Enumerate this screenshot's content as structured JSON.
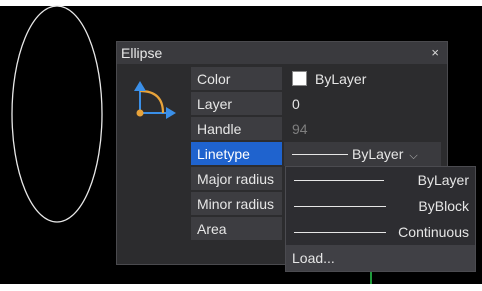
{
  "panel": {
    "title": "Ellipse",
    "close_label": "×"
  },
  "properties": [
    {
      "label": "Color",
      "value": "ByLayer",
      "swatch_color": "#ffffff"
    },
    {
      "label": "Layer",
      "value": "0"
    },
    {
      "label": "Handle",
      "value": "94"
    },
    {
      "label": "Linetype",
      "value": "ByLayer",
      "selected": true
    },
    {
      "label": "Major radius",
      "value": ""
    },
    {
      "label": "Minor radius",
      "value": ""
    },
    {
      "label": "Area",
      "value": ""
    }
  ],
  "linetype_dropdown": {
    "options": [
      "ByLayer",
      "ByBlock",
      "Continuous"
    ],
    "load_label": "Load..."
  },
  "colors": {
    "selection": "#1f63ce",
    "icon_orange": "#e8a33a",
    "icon_blue": "#3a8fe8",
    "canvas": "#000000"
  }
}
